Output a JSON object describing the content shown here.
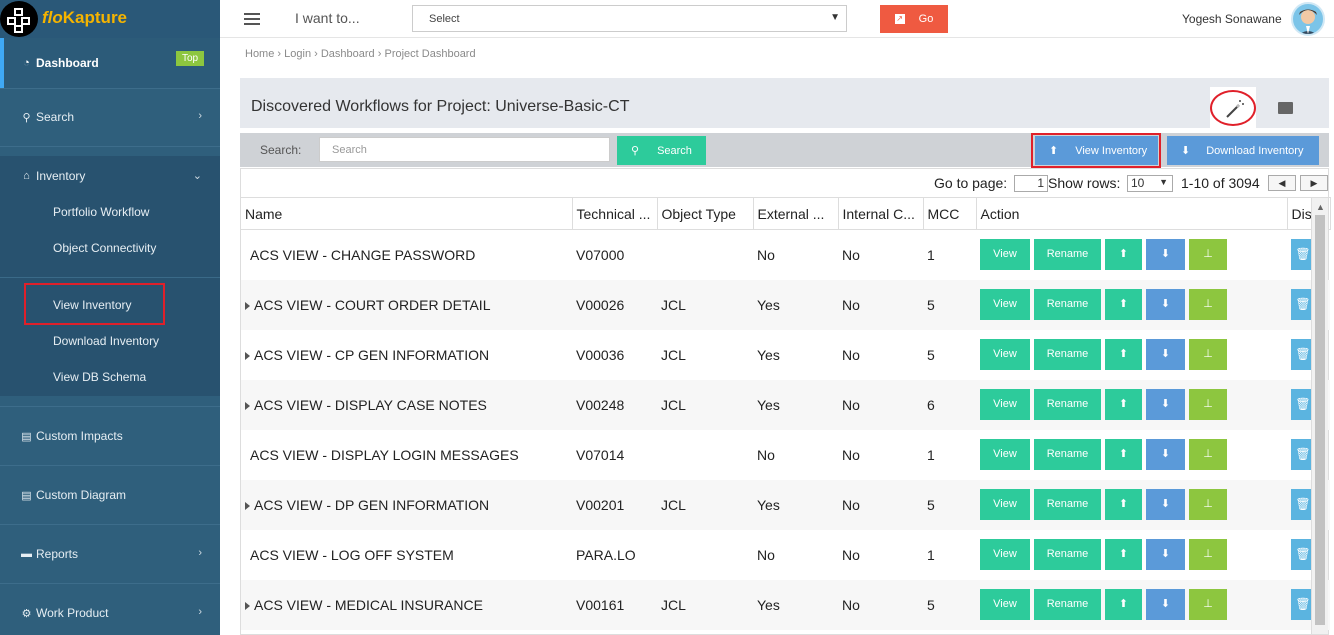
{
  "brand": {
    "name_italic": "flo",
    "name_rest": "Kapture"
  },
  "sidebar": {
    "dashboard": {
      "label": "Dashboard",
      "badge": "Top"
    },
    "search": "Search",
    "inventory": "Inventory",
    "inventory_items": [
      "Portfolio Workflow",
      "Object Connectivity",
      "View Inventory",
      "Download Inventory",
      "View DB Schema"
    ],
    "custom_impacts": "Custom Impacts",
    "custom_diagram": "Custom Diagram",
    "reports": "Reports",
    "work_product": "Work Product"
  },
  "topbar": {
    "i_want_to": "I want to...",
    "select": "Select",
    "go": "Go",
    "user": "Yogesh Sonawane"
  },
  "breadcrumb": [
    "Home",
    "Login",
    "Dashboard",
    "Project Dashboard"
  ],
  "page": {
    "title": "Discovered Workflows for Project: Universe-Basic-CT",
    "search_label": "Search:",
    "search_placeholder": "Search",
    "search_button": "Search",
    "view_inventory": "View Inventory",
    "download_inventory": "Download Inventory"
  },
  "pager": {
    "goto_label": "Go to page:",
    "page": "1",
    "show_rows_label": "Show rows:",
    "rows": "10",
    "range": "1-10 of 3094"
  },
  "table": {
    "headers": [
      "Name",
      "Technical ...",
      "Object Type",
      "External ...",
      "Internal C...",
      "MCC",
      "Action",
      "Dis"
    ],
    "action_labels": {
      "view": "View",
      "rename": "Rename"
    },
    "rows": [
      {
        "name": "ACS VIEW - CHANGE PASSWORD",
        "tech": "V07000",
        "type": "",
        "ext": "No",
        "int": "No",
        "mcc": "1",
        "expand": false
      },
      {
        "name": "ACS VIEW - COURT ORDER DETAIL",
        "tech": "V00026",
        "type": "JCL",
        "ext": "Yes",
        "int": "No",
        "mcc": "5",
        "expand": true
      },
      {
        "name": "ACS VIEW - CP GEN INFORMATION",
        "tech": "V00036",
        "type": "JCL",
        "ext": "Yes",
        "int": "No",
        "mcc": "5",
        "expand": true
      },
      {
        "name": "ACS VIEW - DISPLAY CASE NOTES",
        "tech": "V00248",
        "type": "JCL",
        "ext": "Yes",
        "int": "No",
        "mcc": "6",
        "expand": true
      },
      {
        "name": "ACS VIEW - DISPLAY LOGIN MESSAGES",
        "tech": "V07014",
        "type": "",
        "ext": "No",
        "int": "No",
        "mcc": "1",
        "expand": false
      },
      {
        "name": "ACS VIEW - DP GEN INFORMATION",
        "tech": "V00201",
        "type": "JCL",
        "ext": "Yes",
        "int": "No",
        "mcc": "5",
        "expand": true
      },
      {
        "name": "ACS VIEW - LOG OFF SYSTEM",
        "tech": "PARA.LO",
        "type": "",
        "ext": "No",
        "int": "No",
        "mcc": "1",
        "expand": false
      },
      {
        "name": "ACS VIEW - MEDICAL INSURANCE",
        "tech": "V00161",
        "type": "JCL",
        "ext": "Yes",
        "int": "No",
        "mcc": "5",
        "expand": true
      }
    ]
  },
  "colors": {
    "sidebar": "#2f5f7c",
    "accent_green": "#2dcb9b",
    "accent_blue": "#5b9ad9",
    "tree_green": "#8dc63f",
    "go_red": "#ef5a41"
  }
}
